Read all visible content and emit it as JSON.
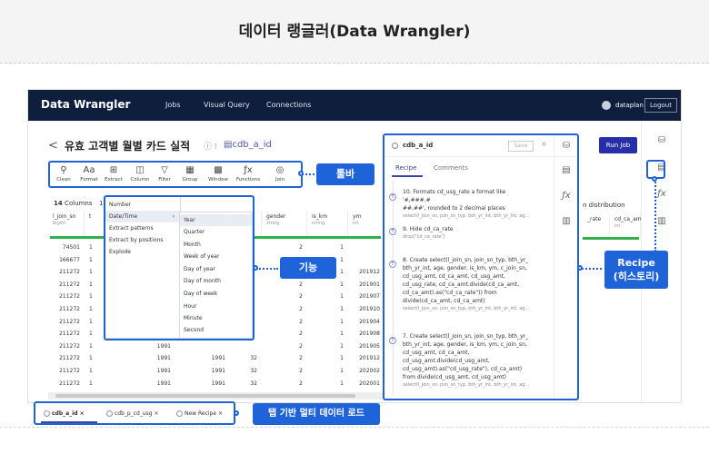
{
  "page": {
    "title": "데이터 랭글러(Data Wrangler)"
  },
  "app": {
    "brand": "Data Wrangler",
    "nav": [
      {
        "label": "Jobs"
      },
      {
        "label": "Visual Query"
      },
      {
        "label": "Connections"
      }
    ],
    "user": "dataplan",
    "logout": "Logout",
    "run_job": "Run Job"
  },
  "dataset": {
    "back": "<",
    "title": "유효 고객별 월별 카드 실적",
    "meta": "ⓘ ⁝",
    "source": "▤cdb_a_id"
  },
  "toolbar": {
    "items": [
      {
        "label": "Clean",
        "icon": "broom-icon"
      },
      {
        "label": "Format",
        "icon": "format-text-icon"
      },
      {
        "label": "Extract",
        "icon": "extract-icon"
      },
      {
        "label": "Column",
        "icon": "column-icon"
      },
      {
        "label": "Filter",
        "icon": "filter-icon"
      },
      {
        "label": "Group",
        "icon": "group-icon"
      },
      {
        "label": "Window",
        "icon": "window-icon"
      },
      {
        "label": "Functions",
        "icon": "function-icon"
      },
      {
        "label": "Join",
        "icon": "join-icon"
      }
    ]
  },
  "grid": {
    "columns_count": "14",
    "columns_label": "Columns",
    "rows_count": "1...",
    "headers": [
      {
        "name": "l_join_sn",
        "type": "bigint"
      },
      {
        "name": "t",
        "type": ""
      },
      {
        "name": "",
        "type": ""
      },
      {
        "name": "",
        "type": ""
      },
      {
        "name": "",
        "type": ""
      },
      {
        "name": "gender",
        "type": "string"
      },
      {
        "name": "is_km",
        "type": "string"
      },
      {
        "name": "ym",
        "type": "int"
      }
    ],
    "rows": [
      [
        "74501",
        "1",
        "",
        "",
        "",
        "2",
        "1",
        ""
      ],
      [
        "166677",
        "1",
        "",
        "",
        "",
        "2",
        "1",
        ""
      ],
      [
        "211272",
        "1",
        "1991",
        "",
        "",
        "2",
        "1",
        "201912"
      ],
      [
        "211272",
        "1",
        "1991",
        "",
        "",
        "2",
        "1",
        "201901"
      ],
      [
        "211272",
        "1",
        "1991",
        "",
        "",
        "2",
        "1",
        "201907"
      ],
      [
        "211272",
        "1",
        "1991",
        "",
        "",
        "2",
        "1",
        "201910"
      ],
      [
        "211272",
        "1",
        "1991",
        "",
        "",
        "2",
        "1",
        "201904"
      ],
      [
        "211272",
        "1",
        "1991",
        "",
        "",
        "2",
        "1",
        "201908"
      ],
      [
        "211272",
        "1",
        "1991",
        "",
        "",
        "2",
        "1",
        "201905"
      ],
      [
        "211272",
        "1",
        "1991",
        "1991",
        "32",
        "2",
        "1",
        "201912"
      ],
      [
        "211272",
        "1",
        "1991",
        "1991",
        "32",
        "2",
        "1",
        "202002"
      ],
      [
        "211272",
        "1",
        "1991",
        "1991",
        "32",
        "2",
        "1",
        "202001"
      ],
      [
        "211272",
        "1",
        "1991",
        "1991",
        "32",
        "2",
        "1",
        "201808"
      ],
      [
        "211272",
        "1",
        "1991",
        "1991",
        "32",
        "2",
        "1",
        "201808"
      ]
    ],
    "distribution": "n distribution",
    "right_headers": [
      {
        "name": "_rate",
        "type": ""
      },
      {
        "name": "cd_ca_amt",
        "type": "int"
      }
    ]
  },
  "menu": {
    "primary": [
      {
        "label": "Number"
      },
      {
        "label": "Date/Time",
        "arrow": "›"
      },
      {
        "label": "Extract patterns"
      },
      {
        "label": "Extract by positions"
      },
      {
        "label": "Explode"
      }
    ],
    "secondary": [
      {
        "label": "Year"
      },
      {
        "label": "Quarter"
      },
      {
        "label": "Month"
      },
      {
        "label": "Week of year"
      },
      {
        "label": "Day of year"
      },
      {
        "label": "Day of month"
      },
      {
        "label": "Day of week"
      },
      {
        "label": "Hour"
      },
      {
        "label": "Minute"
      },
      {
        "label": "Second"
      }
    ]
  },
  "recipe": {
    "title": "cdb_a_id",
    "save": "Save",
    "close": "×",
    "tabs": [
      {
        "label": "Recipe"
      },
      {
        "label": "Comments"
      }
    ],
    "steps": [
      {
        "text": "10. Formats cd_usg_rate a format like '#,###.#",
        "text2": "##,##', rounded to 2 decimal places",
        "sub": "select(l_join_sn, join_sn_typ, bth_yr_int, bth_yr_int, ag..."
      },
      {
        "text": "9. Hide cd_ca_rate",
        "text2": "",
        "sub": "drop(\"cd_ca_rate\")"
      },
      {
        "text": "8. Create select(l_join_sn, join_sn_typ, bth_yr_",
        "text2": "bth_yr_int, age, gender, is_km, ym, c_join_sn, cd_usg_amt, cd_ca_amt, cd_usg_amt, cd_usg_rate, cd_ca_amt.divide(cd_ca_amt, cd_ca_amt).as(\"cd_ca_rate\")) from divide(cd_ca_amt, cd_ca_amt)",
        "sub": "select(l_join_sn, join_sn_typ, bth_yr_int, bth_yr_int, ag..."
      },
      {
        "text": "7. Create select(l_join_sn, join_sn_typ, bth_yr_",
        "text2": "bth_yr_int, age, gender, is_km, ym, c_join_sn, cd_usg_amt, cd_ca_amt, cd_usg_amt.divide(cd_usg_amt, cd_usg_amt).as(\"cd_usg_rate\"), cd_ca_amt) from divide(cd_usg_amt, cd_usg_amt)",
        "sub": "select(l_join_sn, join_sn_typ, bth_yr_int, bth_yr_int, ag..."
      }
    ]
  },
  "tabs": [
    {
      "label": "cdb_a_id"
    },
    {
      "label": "cdb_p_cd_usg"
    },
    {
      "label": "New Recipe"
    }
  ],
  "callouts": {
    "toolbar": "툴바",
    "function": "기능",
    "recipe": "Recipe\n(히스토리)",
    "tabs": "탭 기반 멀티 데이터 로드"
  },
  "colors": {
    "accent": "#1e63d8",
    "nav_bg": "#0f1e3d",
    "run_job": "#272fa8",
    "bar": "#33b04a"
  }
}
